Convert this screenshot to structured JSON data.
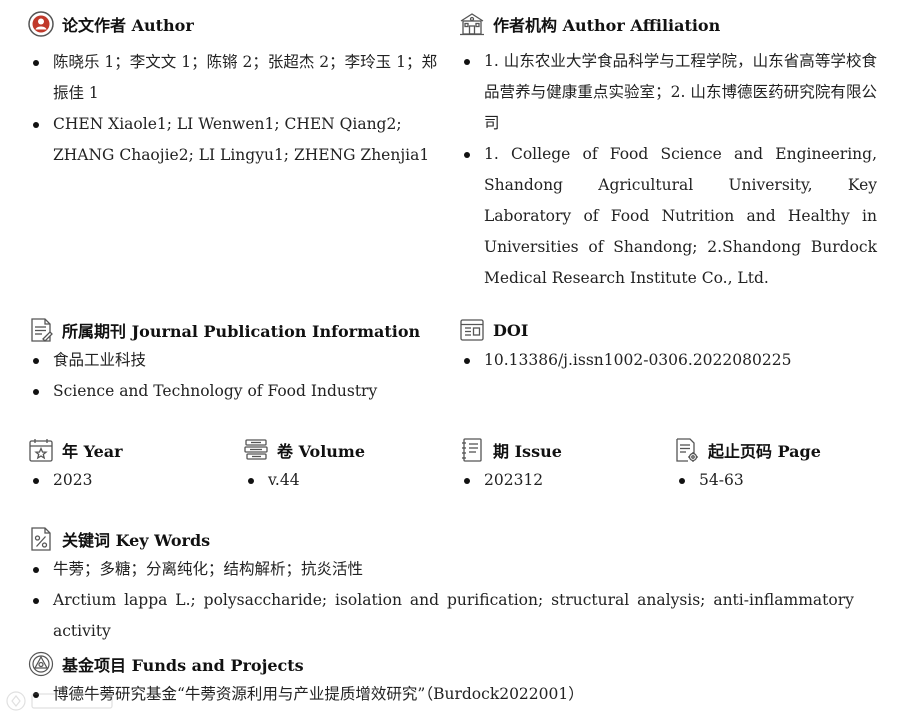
{
  "author": {
    "title": "论文作者 Author",
    "items": [
      "陈晓乐 1；李文文 1；陈锵 2；张超杰 2；李玲玉 1；郑振佳 1",
      "CHEN Xiaole1; LI Wenwen1; CHEN Qiang2; ZHANG Chaojie2; LI Lingyu1; ZHENG Zhenjia1"
    ]
  },
  "affiliation": {
    "title": "作者机构 Author Affiliation",
    "items": [
      "1. 山东农业大学食品科学与工程学院，山东省高等学校食品营养与健康重点实验室；2. 山东博德医药研究院有限公司",
      "1. College of Food Science and Engineering, Shandong Agricultural University, Key Laboratory of Food Nutrition and Healthy in Universities of Shandong; 2.Shandong Burdock Medical Research Institute Co., Ltd."
    ]
  },
  "journal": {
    "title": "所属期刊 Journal Publication Information",
    "items": [
      "食品工业科技",
      "Science and Technology of Food Industry"
    ]
  },
  "doi": {
    "title": "DOI",
    "items": [
      "10.13386/j.issn1002-0306.2022080225"
    ]
  },
  "year": {
    "title": "年 Year",
    "value": "2023"
  },
  "volume": {
    "title": "卷 Volume",
    "value": "v.44"
  },
  "issue": {
    "title": "期 Issue",
    "value": "202312"
  },
  "page": {
    "title": "起止页码 Page",
    "value": "54-63"
  },
  "keywords": {
    "title": "关键词 Key Words",
    "items": [
      "牛蒡；多糖；分离纯化；结构解析；抗炎活性",
      "Arctium lappa L.; polysaccharide; isolation and purification; structural analysis; anti-inflammatory activity"
    ]
  },
  "funds": {
    "title": "基金项目 Funds and Projects",
    "items": [
      "博德牛蒡研究基金“牛蒡资源利用与产业提质增效研究”（Burdock2022001）"
    ]
  },
  "colors": {
    "text": "#1a1a1a",
    "icon_stroke": "#555555",
    "author_icon_accent": "#c0392b"
  },
  "icons": {
    "author": "author-avatar-icon",
    "affiliation": "building-icon",
    "journal": "journal-document-icon",
    "doi": "doi-card-icon",
    "year": "calendar-icon",
    "volume": "books-stack-icon",
    "issue": "notebook-icon",
    "page": "page-gear-icon",
    "keywords": "percent-document-icon",
    "funds": "seal-emblem-icon"
  }
}
